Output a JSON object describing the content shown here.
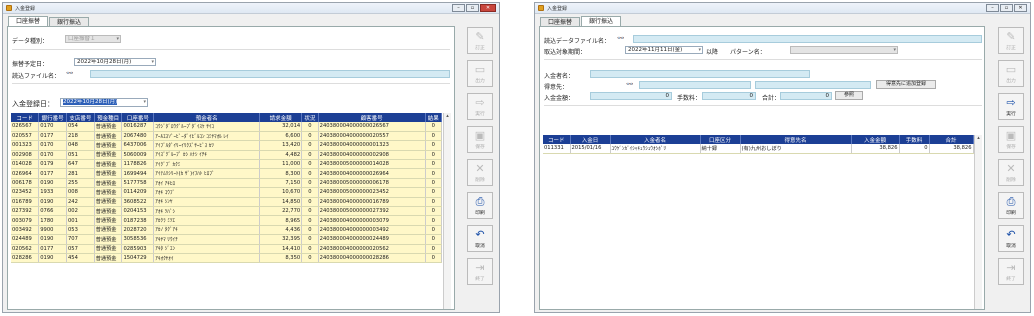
{
  "win1": {
    "title": "入金登録",
    "tabs": [
      "口座振替",
      "銀行振込"
    ],
    "data_type_label": "データ種別：",
    "data_type_value": "口座振替１",
    "transfer_date_label": "振替予定日：",
    "transfer_date_value": "2022年10月28日(月)",
    "read_file_label": "読込ファイル名：",
    "deposit_date_label": "入金登録日：",
    "deposit_date_value": "2022年10月28日(月)",
    "columns": [
      "コード",
      "銀行番号",
      "支店番号",
      "預金種目",
      "口座番号",
      "預金者名",
      "請求金額",
      "状況",
      "顧客番号",
      "結果"
    ],
    "rows": [
      [
        "026567",
        "0170",
        "054",
        "普通預金",
        "0016287",
        "ｺｳｼﾞﾀﾞﾛｳｸﾞﾙｰﾌﾟﾀﾞｲｽｹ ｻｲｺ",
        "32,014",
        "0",
        "240380004000000026567",
        "0"
      ],
      [
        "020557",
        "0177",
        "218",
        "普通預金",
        "2067480",
        "ｱｰﾙｴｽｿﾞｰﾋﾞｰﾀﾞｲﾋﾞﾙｺﾝ ｺﾐﾔﾏｵﾙ ﾚｲ",
        "6,600",
        "0",
        "240380004000000020557",
        "0"
      ],
      [
        "001323",
        "0170",
        "048",
        "普通預金",
        "6437006",
        "ｱｲﾌﾞﾙﾀﾞｲﾘｰｲﾘｸｽﾞｻｰﾋﾞｽ ｶﾂ",
        "13,420",
        "0",
        "240380004000000001323",
        "0"
      ],
      [
        "002908",
        "0170",
        "051",
        "普通預金",
        "5060009",
        "ｱｲｽﾞｸﾞﾙｰﾌﾟ ｶｼ ﾊﾅｼ ｲﾁｷ",
        "4,482",
        "0",
        "240380004000000002908",
        "0"
      ],
      [
        "014028",
        "0179",
        "647",
        "普通預金",
        "1178826",
        "ｱｲｸﾞﾌﾞ ｶｸﾐ",
        "11,000",
        "0",
        "240380005000000014028",
        "0"
      ],
      [
        "026964",
        "0177",
        "281",
        "普通預金",
        "1699494",
        "ｱｲﾃﾑﾘｼﾘｰﾄ(ｶ ｻﾞ)ｲﾌﾊﾄ ﾋﾛﾌﾞ",
        "8,300",
        "0",
        "240380004000000026964",
        "0"
      ],
      [
        "006178",
        "0190",
        "255",
        "普通預金",
        "5177758",
        "ｱｵｲ ｱｷﾋﾛ",
        "7,150",
        "0",
        "240380005000000006178",
        "0"
      ],
      [
        "023452",
        "1933",
        "008",
        "普通預金",
        "0114209",
        "ｱｵｷ ｺｳﾌﾞ",
        "10,670",
        "0",
        "240380005000000023452",
        "0"
      ],
      [
        "016789",
        "0190",
        "242",
        "普通預金",
        "3608522",
        "ｱｵｷ ｼﾝﾔ",
        "14,850",
        "0",
        "240380004000000016789",
        "0"
      ],
      [
        "027392",
        "0766",
        "002",
        "普通預金",
        "0204153",
        "ｱｵｷ ﾂﾊﾞｼ",
        "22,770",
        "0",
        "240380005000000027392",
        "0"
      ],
      [
        "003079",
        "1780",
        "001",
        "普通預金",
        "0187238",
        "ｱｶｸﾗ ﾐﾂｴ",
        "8,965",
        "0",
        "240380004000000003079",
        "0"
      ],
      [
        "003492",
        "9900",
        "053",
        "普通預金",
        "2028720",
        "ｱｶﾉ ﾀｸﾞｱｷ",
        "4,436",
        "0",
        "240380004000000003492",
        "0"
      ],
      [
        "024489",
        "0190",
        "707",
        "普通預金",
        "3058536",
        "ｱｷﾔﾏ ﾘｳｲﾁ",
        "32,395",
        "0",
        "240380004000000024489",
        "0"
      ],
      [
        "020562",
        "0177",
        "057",
        "普通預金",
        "0285903",
        "ｱｷﾀ ｼﾞｴﾝ",
        "14,410",
        "0",
        "240380004000000020562",
        "0"
      ],
      [
        "028286",
        "0190",
        "454",
        "普通預金",
        "1504729",
        "ｱｷｵｸﾔｵｲ",
        "8,350",
        "0",
        "240380004000000028286",
        "0"
      ]
    ],
    "side_buttons": [
      {
        "icon": "✎",
        "label": "訂正",
        "enabled": false,
        "name": "edit"
      },
      {
        "icon": "▭",
        "label": "出力",
        "enabled": false,
        "name": "output"
      },
      {
        "icon": "⇨",
        "label": "実行",
        "enabled": false,
        "name": "execute"
      },
      {
        "icon": "▣",
        "label": "保存",
        "enabled": false,
        "name": "save"
      },
      {
        "icon": "✕",
        "label": "削除",
        "enabled": false,
        "name": "delete"
      },
      {
        "icon": "⎙",
        "label": "印刷",
        "enabled": true,
        "name": "print"
      },
      {
        "icon": "↶",
        "label": "取消",
        "enabled": true,
        "name": "undo"
      },
      {
        "icon": "⇥",
        "label": "終了",
        "enabled": false,
        "name": "exit"
      }
    ]
  },
  "win2": {
    "title": "入金登録",
    "tabs": [
      "口座振替",
      "銀行振込"
    ],
    "read_file_label": "読込データファイル名：",
    "period_label": "取込対象期間：",
    "period_value": "2022年11月11日(金)",
    "period_suffix": "以降",
    "pattern_label": "パターン名：",
    "payer_label": "入金者名：",
    "customer_label": "得意先：",
    "add_customer_button": "得意先に追加登録",
    "amount_label": "入金金額：",
    "amount_value": "0",
    "fee_label": "手数料：",
    "fee_value": "0",
    "total_label": "合計：",
    "total_value": "0",
    "apply_button": "参照",
    "columns": [
      "コード",
      "入金日",
      "入金者名",
      "口座区分",
      "得意先名",
      "入金金額",
      "手数料",
      "合計"
    ],
    "rows": [
      [
        "011331",
        "2015/01/16",
        "ﾕｳｹﾞﾝｶﾞｲｼｬｷｭｳｼｭｳｵｼﾎﾞﾘ",
        "納十録",
        "(有)九州おしぼり",
        "38,826",
        "0",
        "38,826"
      ]
    ],
    "side_buttons": [
      {
        "icon": "✎",
        "label": "訂正",
        "enabled": false,
        "name": "edit"
      },
      {
        "icon": "▭",
        "label": "出力",
        "enabled": false,
        "name": "output"
      },
      {
        "icon": "⇨",
        "label": "実行",
        "enabled": true,
        "name": "execute"
      },
      {
        "icon": "▣",
        "label": "保存",
        "enabled": false,
        "name": "save"
      },
      {
        "icon": "✕",
        "label": "削除",
        "enabled": false,
        "name": "delete"
      },
      {
        "icon": "⎙",
        "label": "印刷",
        "enabled": true,
        "name": "print"
      },
      {
        "icon": "↶",
        "label": "取消",
        "enabled": true,
        "name": "undo"
      },
      {
        "icon": "⇥",
        "label": "終了",
        "enabled": false,
        "name": "exit"
      }
    ]
  }
}
